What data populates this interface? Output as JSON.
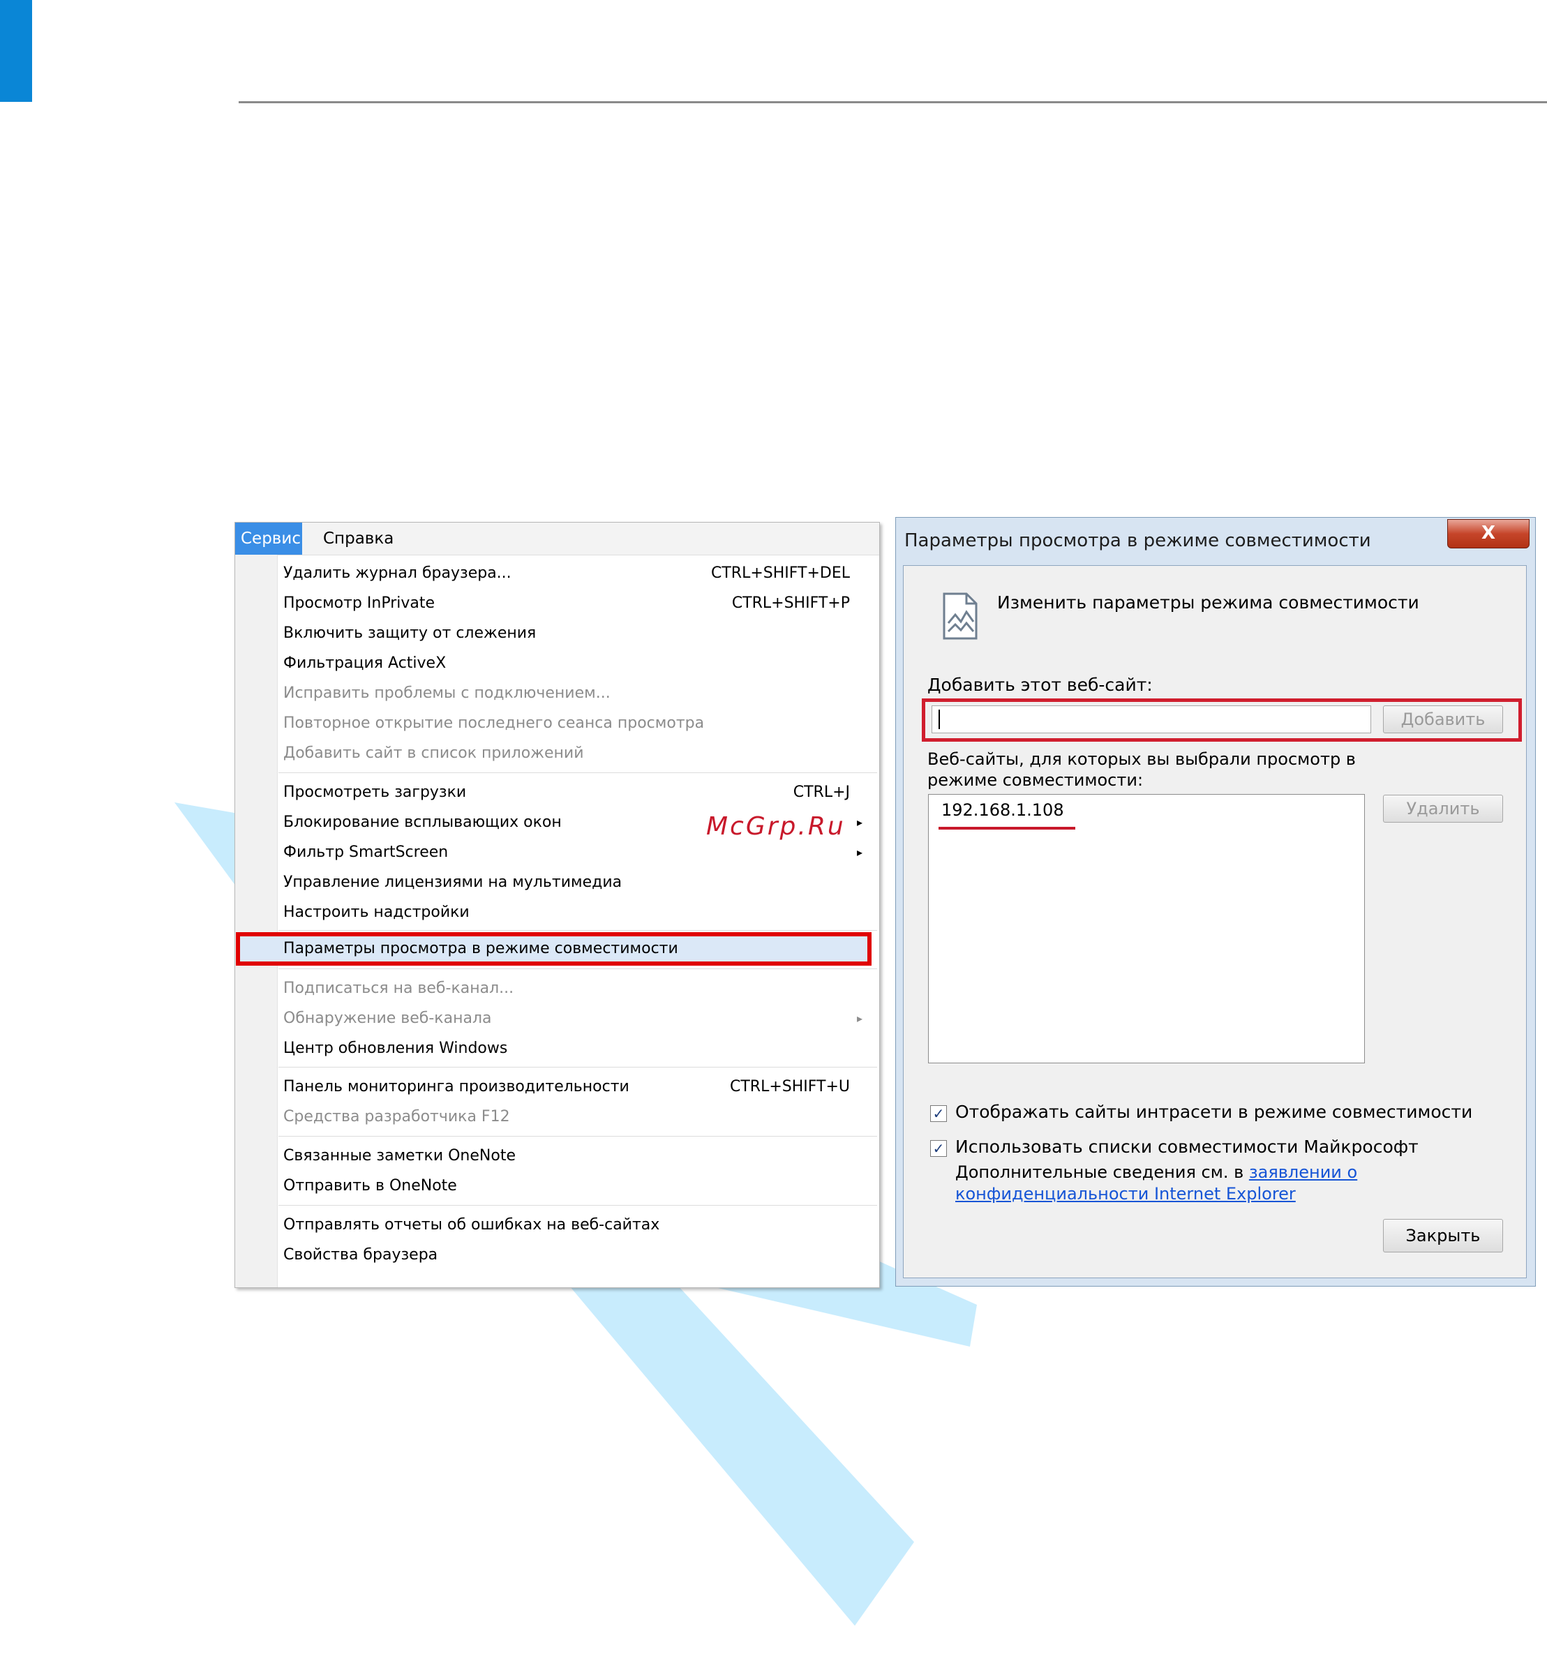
{
  "menubar": {
    "service": "Сервис",
    "help": "Справка"
  },
  "menu_items": [
    {
      "label": "Удалить журнал браузера...",
      "shortcut": "CTRL+SHIFT+DEL"
    },
    {
      "label": "Просмотр InPrivate",
      "shortcut": "CTRL+SHIFT+P"
    },
    {
      "label": "Включить защиту от слежения"
    },
    {
      "label": "Фильтрация ActiveX"
    },
    {
      "label": "Исправить проблемы с подключением...",
      "disabled": true
    },
    {
      "label": "Повторное открытие последнего сеанса просмотра",
      "disabled": true
    },
    {
      "label": "Добавить сайт в список приложений",
      "disabled": true
    },
    {
      "label": "Просмотреть загрузки",
      "shortcut": "CTRL+J"
    },
    {
      "label": "Блокирование всплывающих окон",
      "submenu": true
    },
    {
      "label": "Фильтр SmartScreen",
      "submenu": true
    },
    {
      "label": "Управление лицензиями на мультимедиа"
    },
    {
      "label": "Настроить надстройки"
    },
    {
      "label": "Параметры просмотра в режиме совместимости",
      "highlighted": true
    },
    {
      "label": "Подписаться на веб-канал...",
      "disabled": true
    },
    {
      "label": "Обнаружение веб-канала",
      "disabled": true,
      "submenu": true
    },
    {
      "label": "Центр обновления Windows"
    },
    {
      "label": "Панель мониторинга производительности",
      "shortcut": "CTRL+SHIFT+U"
    },
    {
      "label": "Средства разработчика F12",
      "disabled": true
    },
    {
      "label": "Связанные заметки OneNote"
    },
    {
      "label": "Отправить в OneNote"
    },
    {
      "label": "Отправлять отчеты об ошибках на веб-сайтах"
    },
    {
      "label": "Свойства браузера"
    }
  ],
  "watermark": "McGrp.Ru",
  "dialog": {
    "title": "Параметры просмотра в режиме совместимости",
    "close_glyph": "X",
    "header": "Изменить параметры режима совместимости",
    "add_label": "Добавить этот веб-сайт:",
    "add_input_value": "",
    "add_button": "Добавить",
    "list_label": "Веб-сайты, для которых вы выбрали просмотр в режиме совместимости:",
    "sites": [
      "192.168.1.108"
    ],
    "delete_button": "Удалить",
    "checkbox_intranet": {
      "label": "Отображать сайты интрасети в режиме совместимости",
      "checked": true
    },
    "checkbox_ms_lists": {
      "label": "Использовать списки совместимости Майкрософт",
      "checked": true
    },
    "info_prefix": "Дополнительные сведения см. в ",
    "info_link": "заявлении о конфиденциальности Internet Explorer",
    "close_button": "Закрыть"
  },
  "colors": {
    "accent_tab": "#0a86d6",
    "highlight_box": "#e00000",
    "watermark_text": "#c8192b",
    "watermark_shape": "#c8ecfd",
    "link": "#1655d6"
  }
}
